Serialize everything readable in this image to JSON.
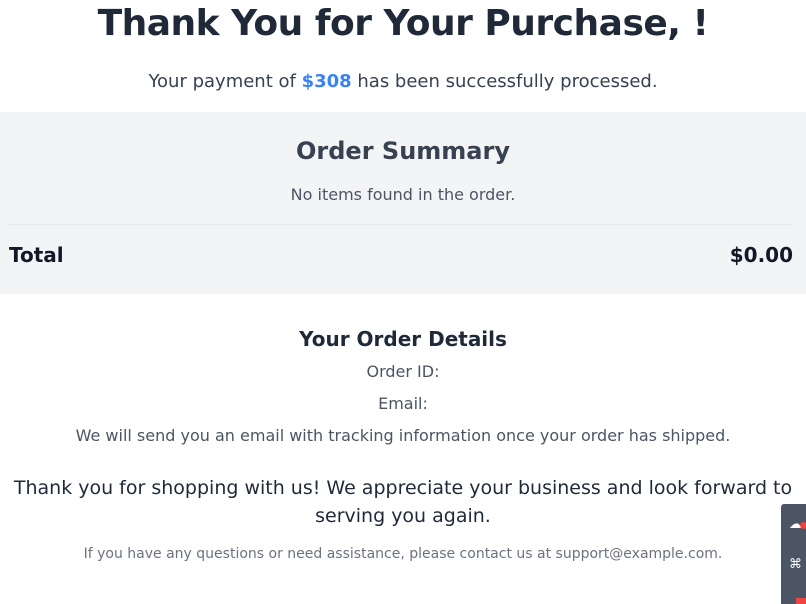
{
  "header": {
    "title": "Thank You for Your Purchase, !",
    "payment_prefix": "Your payment of ",
    "payment_amount": "$308",
    "payment_suffix": " has been successfully processed."
  },
  "summary": {
    "title": "Order Summary",
    "empty_message": "No items found in the order.",
    "total_label": "Total",
    "total_value": "$0.00"
  },
  "details": {
    "title": "Your Order Details",
    "order_id_label": "Order ID:",
    "email_label": "Email:",
    "tracking_message": "We will send you an email with tracking information once your order has shipped."
  },
  "footer": {
    "thanks_message": "Thank you for shopping with us! We appreciate your business and look forward to serving you again.",
    "contact_message": "If you have any questions or need assistance, please contact us at support@example.com."
  },
  "colors": {
    "accent": "#3b82f6",
    "summary_background": "#f3f4f6",
    "heading": "#1f2937"
  },
  "side_widget": {
    "icons": [
      "chat-icon",
      "grid-icon",
      "alert-icon"
    ]
  }
}
